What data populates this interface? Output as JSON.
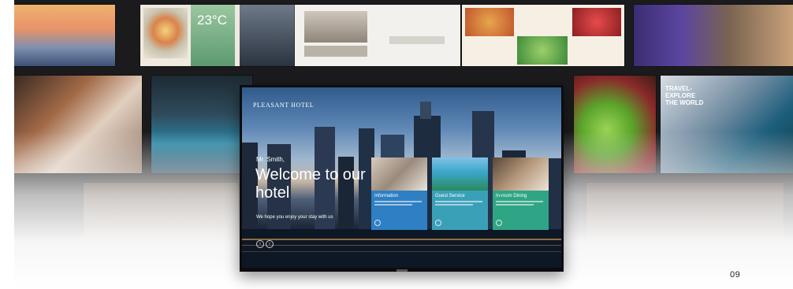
{
  "page_number": "09",
  "tv": {
    "hotel_logo": "PLEASANT HOTEL",
    "guest_name": "Mr. Smith,",
    "welcome_title": "Welcome to our hotel",
    "welcome_subtitle": "We hope you enjoy your stay with us",
    "cards": [
      {
        "title": "Information",
        "color": "#2f7fc4"
      },
      {
        "title": "Guest Service",
        "color": "#3aa0b8"
      },
      {
        "title": "In-room Dining",
        "color": "#2fa585"
      }
    ]
  },
  "background_tiles": {
    "temperature": "23°C",
    "travel_tile": "TRAVEL-\nEXPLORE\nTHE WORLD"
  }
}
